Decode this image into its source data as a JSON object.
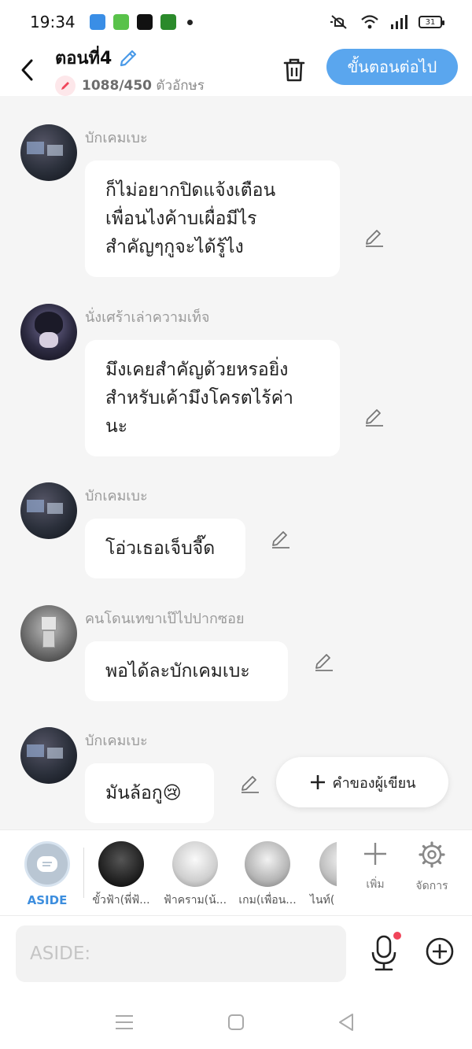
{
  "status_bar": {
    "time": "19:34",
    "battery": "31"
  },
  "header": {
    "title": "ตอนที่4",
    "char_count": "1088/450",
    "char_unit": "ตัวอักษร",
    "next_button": "ขั้นตอนต่อไป"
  },
  "messages": [
    {
      "sender": "บักเคมเบะ",
      "lines": [
        "ก็ไม่อยากปิดแจ้งเตือน",
        "เพื่อนไงค้าบเผื่อมีไร",
        "สำคัญๆกูจะได้รู้ไง"
      ]
    },
    {
      "sender": "นั่งเศร้าเล่าความเท็จ",
      "lines": [
        "มึงเคยสำคัญด้วยหรอยิ่ง",
        "สำหรับเค้ามึงโครตไร้ค่า",
        "นะ"
      ]
    },
    {
      "sender": "บักเคมเบะ",
      "lines": [
        "โอ่วเธอเจ็บจี๊ด"
      ]
    },
    {
      "sender": "คนโดนเทขาเป๊ไปปากซอย",
      "lines": [
        "พอได้ละบักเคมเบะ"
      ]
    },
    {
      "sender": "บักเคมเบะ",
      "lines": [
        "มันล้อกู😢"
      ]
    }
  ],
  "author_note_button": "คำของผู้เขียน",
  "characters": {
    "aside_label": "ASIDE",
    "items": [
      "ขั้วฟ้า(พี่ฟ้...",
      "ฟ้าคราม(น้...",
      "เกม(เพื่อน...",
      "ไนท์("
    ],
    "add_label": "เพิ่ม",
    "manage_label": "จัดการ"
  },
  "input": {
    "placeholder": "ASIDE:"
  },
  "colors": {
    "accent": "#5aa6ee",
    "aside": "#3d8ede"
  }
}
